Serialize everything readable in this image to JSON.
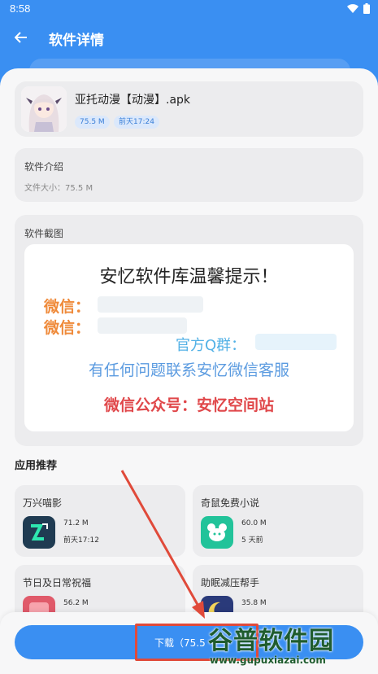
{
  "status_bar": {
    "time": "8:58"
  },
  "appbar": {
    "title": "软件详情"
  },
  "app": {
    "name": "亚托动漫【动漫】.apk",
    "size_tag": "75.5 M",
    "time_tag": "前天17:24"
  },
  "intro": {
    "label": "软件介绍",
    "size_text": "文件大小：75.5 M"
  },
  "screenshot": {
    "label": "软件截图",
    "heading": "安忆软件库温馨提示！",
    "wechat1": "微信：",
    "wechat2": "微信：",
    "qq": "官方Q群：",
    "tip": "有任何问题联系安忆微信客服",
    "public": "微信公众号：安忆空间站"
  },
  "recommend": {
    "title": "应用推荐",
    "items": [
      {
        "name": "万兴喵影",
        "size": "71.2 M",
        "time": "前天17:12",
        "icon": "film-editor-icon",
        "color": "#1f3b52"
      },
      {
        "name": "奇鼠免费小说",
        "size": "60.0 M",
        "time": "5 天前",
        "icon": "mouse-book-icon",
        "color": "#22c39a"
      },
      {
        "name": "节日及日常祝福",
        "size": "56.2 M",
        "time": "",
        "icon": "greeting-icon",
        "color": "#e05a6a"
      },
      {
        "name": "助眠减压帮手",
        "size": "35.8 M",
        "time": "",
        "icon": "moon-sleep-icon",
        "color": "#2a3a7a"
      }
    ]
  },
  "download": {
    "label": "下载（75.5"
  },
  "watermark": {
    "brand": "谷普软件园",
    "url": "www.gupuxiazai.com"
  }
}
